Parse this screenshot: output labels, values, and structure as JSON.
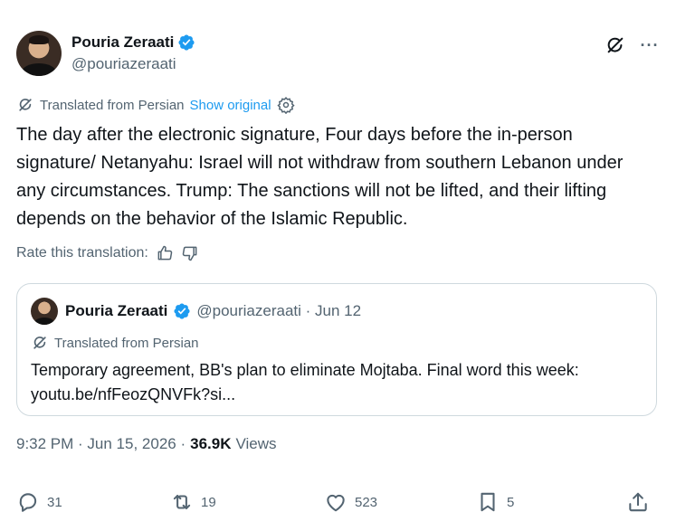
{
  "author": {
    "display_name": "Pouria Zeraati",
    "handle": "@pouriazeraati",
    "verified": true
  },
  "header_icons": [
    "grok-icon",
    "more-icon"
  ],
  "more_label": "···",
  "translation": {
    "label": "Translated from Persian",
    "show_original": "Show original"
  },
  "tweet": {
    "text": "The day after the electronic signature,  Four days before the in-person signature/ Netanyahu:  Israel will not withdraw from southern Lebanon under any circumstances. Trump:  The sanctions will not be lifted, and their lifting depends on the behavior of the Islamic Republic."
  },
  "rate": {
    "label": "Rate this translation:"
  },
  "quote": {
    "display_name": "Pouria Zeraati",
    "handle_date": "@pouriazeraati · Jun 12",
    "translated_label": "Translated from Persian",
    "text": "Temporary agreement, BB's plan to eliminate Mojtaba. Final word this week: youtu.be/nfFeozQNVFk?si..."
  },
  "meta": {
    "time_date": "9:32 PM · Jun 15, 2026 ·",
    "views_count": "36.9K",
    "views_label": "Views"
  },
  "actions": {
    "replies": "31",
    "reposts": "19",
    "likes": "523",
    "bookmarks": "5"
  },
  "colors": {
    "accent": "#1d9bf0",
    "secondary_text": "#536471",
    "primary_text": "#0f1419",
    "border": "#cfd9de"
  }
}
